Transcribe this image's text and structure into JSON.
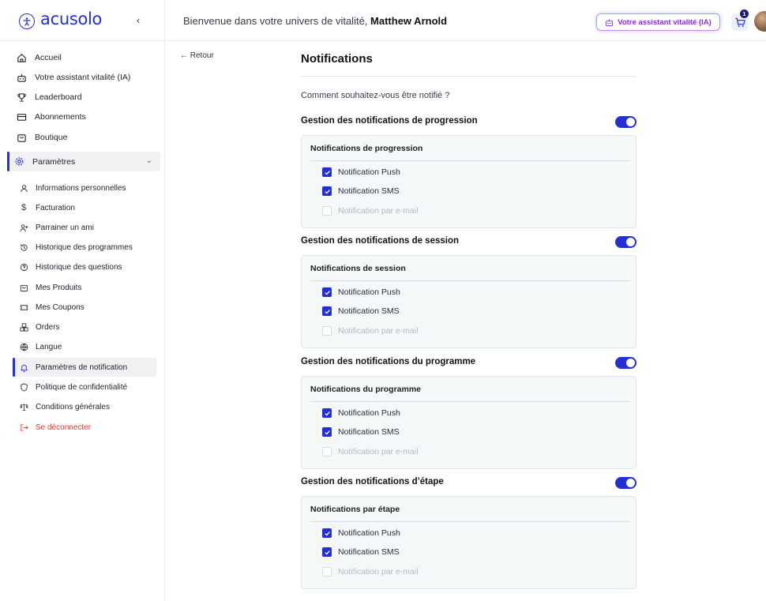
{
  "app": {
    "logo_text": "acusolo"
  },
  "sidebar": {
    "collapse_glyph": "‹",
    "main_items": [
      {
        "label": "Accueil",
        "icon": "home-icon"
      },
      {
        "label": "Votre assistant vitalité (IA)",
        "icon": "robot-icon"
      },
      {
        "label": "Leaderboard",
        "icon": "trophy-icon"
      },
      {
        "label": "Abonnements",
        "icon": "card-icon"
      },
      {
        "label": "Boutique",
        "icon": "shopping-bag-icon"
      }
    ],
    "params": {
      "label": "Paramètres",
      "icon": "gear-icon",
      "expanded": true
    },
    "sub_items": [
      {
        "label": "Informations personnelles",
        "icon": "user-icon"
      },
      {
        "label": "Facturation",
        "icon": "dollar-icon"
      },
      {
        "label": "Parrainer un ami",
        "icon": "user-plus-icon"
      },
      {
        "label": "Historique des programmes",
        "icon": "history-icon"
      },
      {
        "label": "Historique des questions",
        "icon": "help-circle-icon"
      },
      {
        "label": "Mes Produits",
        "icon": "shopping-bag-icon"
      },
      {
        "label": "Mes Coupons",
        "icon": "ticket-icon"
      },
      {
        "label": "Orders",
        "icon": "boxes-icon"
      },
      {
        "label": "Langue",
        "icon": "globe-icon"
      },
      {
        "label": "Paramètres de notification",
        "icon": "bell-icon",
        "active": true
      },
      {
        "label": "Politique de confidentialité",
        "icon": "shield-icon"
      },
      {
        "label": "Conditions générales",
        "icon": "scale-icon"
      },
      {
        "label": "Se déconnecter",
        "icon": "logout-icon",
        "danger": true
      }
    ]
  },
  "header": {
    "welcome_prefix": "Bienvenue dans votre univers de vitalité,",
    "user_name": "Matthew Arnold",
    "assistant_button": "Votre assistant vitalité (IA)",
    "cart_count": "1"
  },
  "main": {
    "back_label": "← Retour",
    "title": "Notifications",
    "question": "Comment souhaitez-vous être notifié ?",
    "sections": [
      {
        "title": "Gestion des notifications de progression",
        "enabled": true,
        "card_title": "Notifications de progression",
        "options": [
          {
            "label": "Notification Push",
            "checked": true,
            "disabled": false
          },
          {
            "label": "Notification SMS",
            "checked": true,
            "disabled": false
          },
          {
            "label": "Notification par e-mail",
            "checked": false,
            "disabled": true
          }
        ]
      },
      {
        "title": "Gestion des notifications de session",
        "enabled": true,
        "card_title": "Notifications de session",
        "options": [
          {
            "label": "Notification Push",
            "checked": true,
            "disabled": false
          },
          {
            "label": "Notification SMS",
            "checked": true,
            "disabled": false
          },
          {
            "label": "Notification par e-mail",
            "checked": false,
            "disabled": true
          }
        ]
      },
      {
        "title": "Gestion des notifications du programme",
        "enabled": true,
        "card_title": "Notifications du programme",
        "options": [
          {
            "label": "Notification Push",
            "checked": true,
            "disabled": false
          },
          {
            "label": "Notification SMS",
            "checked": true,
            "disabled": false
          },
          {
            "label": "Notification par e-mail",
            "checked": false,
            "disabled": true
          }
        ]
      },
      {
        "title": "Gestion des notifications d’étape",
        "enabled": true,
        "card_title": "Notifications par étape",
        "options": [
          {
            "label": "Notification Push",
            "checked": true,
            "disabled": false
          },
          {
            "label": "Notification SMS",
            "checked": true,
            "disabled": false
          },
          {
            "label": "Notification par e-mail",
            "checked": false,
            "disabled": true
          }
        ]
      }
    ]
  },
  "colors": {
    "accent": "#2330d6",
    "danger": "#e53935",
    "card_bg": "#f4f8f8",
    "assistant": "#8a2be2"
  }
}
